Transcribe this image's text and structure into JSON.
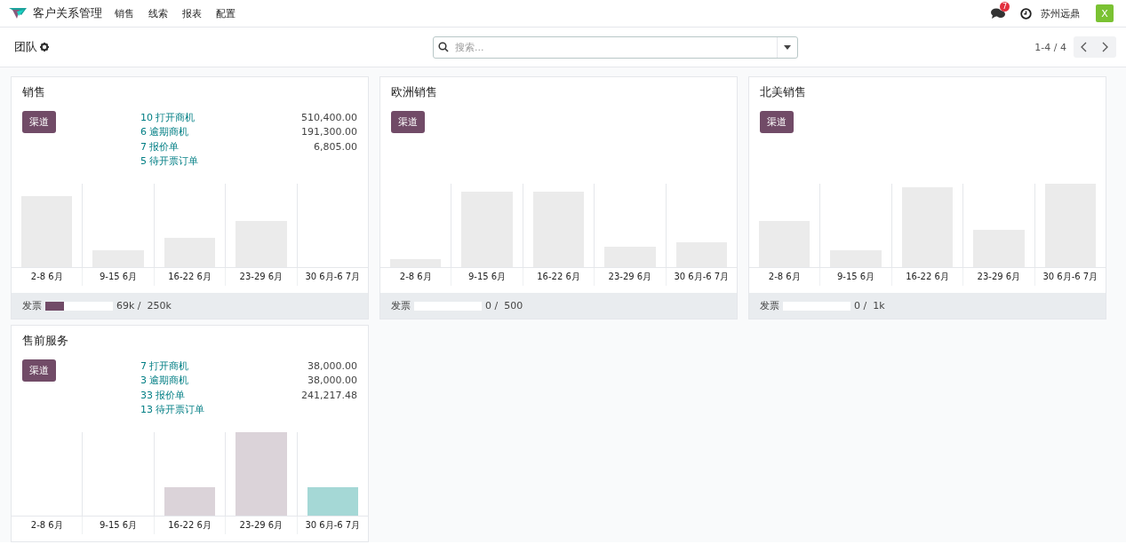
{
  "navbar": {
    "app_name": "客户关系管理",
    "menu": [
      "销售",
      "线索",
      "报表",
      "配置"
    ],
    "message_count": "7",
    "company": "苏州远鼎",
    "avatar_letter": "X"
  },
  "control_panel": {
    "title": "团队",
    "search": {
      "placeholder": "搜索..."
    },
    "pager": "1-4 / 4"
  },
  "teams": [
    {
      "name": "销售",
      "button": "渠道",
      "stats": [
        {
          "label": "10 打开商机",
          "amount": "510,400.00"
        },
        {
          "label": "6 逾期商机",
          "amount": "191,300.00"
        },
        {
          "label": "7 报价单",
          "amount": "6,805.00"
        },
        {
          "label": "5 待开票订单"
        }
      ],
      "chart_labels": [
        "2-8 6月",
        "9-15 6月",
        "16-22 6月",
        "23-29 6月",
        "30 6月-6 7月"
      ],
      "invoicing": {
        "label": "发票",
        "level": 0.276,
        "reading": "69k /  250k"
      }
    },
    {
      "name": "欧洲销售",
      "button": "渠道",
      "chart_labels": [
        "2-8 6月",
        "9-15 6月",
        "16-22 6月",
        "23-29 6月",
        "30 6月-6 7月"
      ],
      "invoicing": {
        "label": "发票",
        "level": 0,
        "reading": "0 /  500"
      }
    },
    {
      "name": "北美销售",
      "button": "渠道",
      "chart_labels": [
        "2-8 6月",
        "9-15 6月",
        "16-22 6月",
        "23-29 6月",
        "30 6月-6 7月"
      ],
      "invoicing": {
        "label": "发票",
        "level": 0,
        "reading": "0 /  1k"
      }
    },
    {
      "name": "售前服务",
      "button": "渠道",
      "stats": [
        {
          "label": "7 打开商机",
          "amount": "38,000.00"
        },
        {
          "label": "3 逾期商机",
          "amount": "38,000.00"
        },
        {
          "label": "33 报价单",
          "amount": "241,217.48"
        },
        {
          "label": "13 待开票订单"
        }
      ],
      "chart_labels": [
        "2-8 6月",
        "9-15 6月",
        "16-22 6月",
        "23-29 6月",
        "30 6月-6 7月"
      ]
    }
  ]
}
